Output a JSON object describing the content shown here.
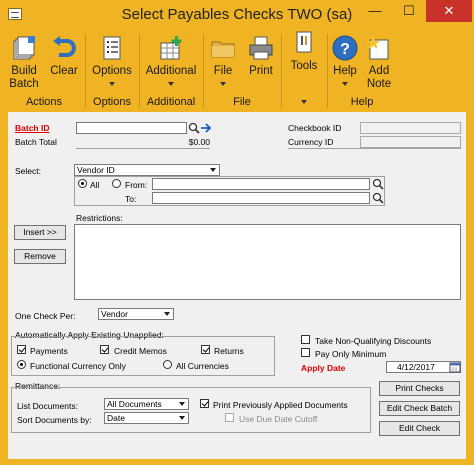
{
  "window": {
    "title": "Select Payables Checks   TWO (sa)",
    "minimize": "—",
    "maximize": "☐",
    "close": "✕"
  },
  "ribbon": {
    "groups": [
      {
        "label": "Actions",
        "buttons": [
          {
            "label": "Build\nBatch",
            "icon": "build-batch-icon"
          },
          {
            "label": "Clear",
            "icon": "clear-undo-icon"
          }
        ]
      },
      {
        "label": "Options",
        "buttons": [
          {
            "label": "Options",
            "icon": "options-list-icon"
          }
        ]
      },
      {
        "label": "Additional",
        "buttons": [
          {
            "label": "Additional",
            "icon": "additional-grid-icon"
          }
        ]
      },
      {
        "label": "File",
        "buttons": [
          {
            "label": "File",
            "icon": "folder-icon"
          },
          {
            "label": "Print",
            "icon": "printer-icon"
          }
        ]
      },
      {
        "label": "",
        "buttons": [
          {
            "label": "Tools",
            "icon": "tools-icon"
          }
        ]
      },
      {
        "label": "Help",
        "buttons": [
          {
            "label": "Help",
            "icon": "help-icon"
          },
          {
            "label": "Add\nNote",
            "icon": "add-note-icon"
          }
        ]
      }
    ]
  },
  "form": {
    "batch_id_label": "Batch ID",
    "batch_id_value": "",
    "batch_total_label": "Batch Total",
    "batch_total_value": "$0.00",
    "checkbook_id_label": "Checkbook ID",
    "currency_id_label": "Currency ID",
    "select_label": "Select:",
    "select_value": "Vendor ID",
    "all_label": "All",
    "from_label": "From:",
    "to_label": "To:",
    "restrictions_label": "Restrictions:",
    "insert_button": "Insert >>",
    "remove_button": "Remove",
    "one_check_per_label": "One Check Per:",
    "one_check_per_value": "Vendor",
    "auto_apply_label": "Automatically Apply Existing Unapplied:",
    "payments_label": "Payments",
    "credit_memos_label": "Credit Memos",
    "returns_label": "Returns",
    "functional_currency_label": "Functional Currency Only",
    "all_currencies_label": "All Currencies",
    "take_non_qualifying_label": "Take Non-Qualifying Discounts",
    "pay_only_minimum_label": "Pay Only Minimum",
    "apply_date_label": "Apply Date",
    "apply_date_value": "4/12/2017",
    "remittance_label": "Remittance:",
    "list_documents_label": "List Documents:",
    "list_documents_value": "All Documents",
    "sort_documents_label": "Sort Documents by:",
    "sort_documents_value": "Date",
    "print_prev_applied_label": "Print Previously Applied Documents",
    "use_due_date_cutoff_label": "Use Due Date Cutoff",
    "print_checks_button": "Print Checks",
    "edit_check_batch_button": "Edit Check Batch",
    "edit_check_button": "Edit Check"
  },
  "colors": {
    "ribbon": "#f0b323",
    "close": "#c7332b",
    "required": "#dd0000",
    "panel": "#f0f0f0"
  }
}
